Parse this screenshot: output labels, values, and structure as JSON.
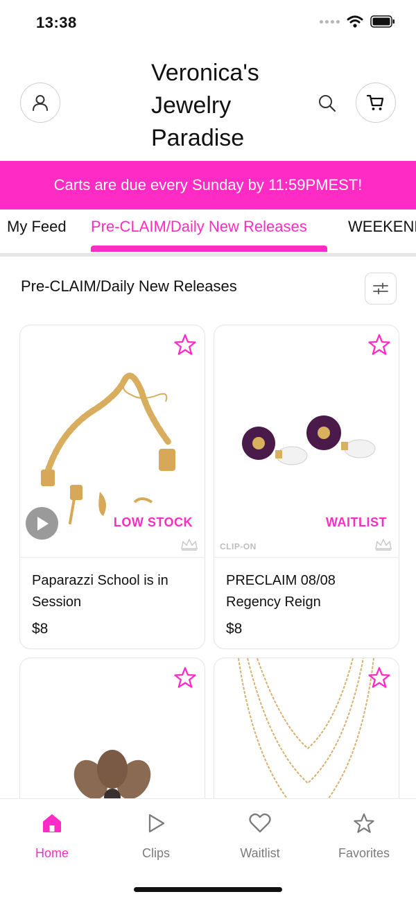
{
  "status_bar": {
    "time": "13:38",
    "icons": [
      "signal-dots-icon",
      "wifi-icon",
      "battery-icon"
    ]
  },
  "header": {
    "store_title": "Veronica's Jewelry Paradise",
    "profile_icon": "user-icon",
    "search_icon": "search-icon",
    "cart_icon": "cart-icon"
  },
  "banner": {
    "text": "Carts are due every Sunday by 11:59PMEST!",
    "color": "#ff2bc4"
  },
  "tabs": [
    {
      "label": "My Feed",
      "active": false
    },
    {
      "label": "Pre-CLAIM/Daily New Releases",
      "active": true
    },
    {
      "label": "WEEKEND",
      "active": false
    }
  ],
  "section": {
    "title": "Pre-CLAIM/Daily New Releases",
    "filter_icon": "sliders-icon"
  },
  "products": [
    {
      "name": "Paparazzi School is in Session",
      "price": "$8",
      "badge": "LOW STOCK",
      "has_video": true,
      "image": "gold charm bracelet"
    },
    {
      "name": "PRECLAIM 08/08 Regency Reign",
      "price": "$8",
      "badge": "WAITLIST",
      "tag": "CLIP-ON",
      "image": "purple flower pearl drop earrings"
    },
    {
      "name": "",
      "price": "",
      "badge": "",
      "image": "flower ring"
    },
    {
      "name": "",
      "price": "",
      "badge": "",
      "image": "layered gold chain necklace"
    }
  ],
  "tabbar": {
    "items": [
      {
        "label": "Home",
        "icon": "home-icon",
        "active": true
      },
      {
        "label": "Clips",
        "icon": "play-icon",
        "active": false
      },
      {
        "label": "Waitlist",
        "icon": "heart-icon",
        "active": false
      },
      {
        "label": "Favorites",
        "icon": "star-icon",
        "active": false
      }
    ]
  },
  "colors": {
    "accent": "#ff2bc4",
    "inactive": "#7b7b7b",
    "text": "#111111"
  }
}
